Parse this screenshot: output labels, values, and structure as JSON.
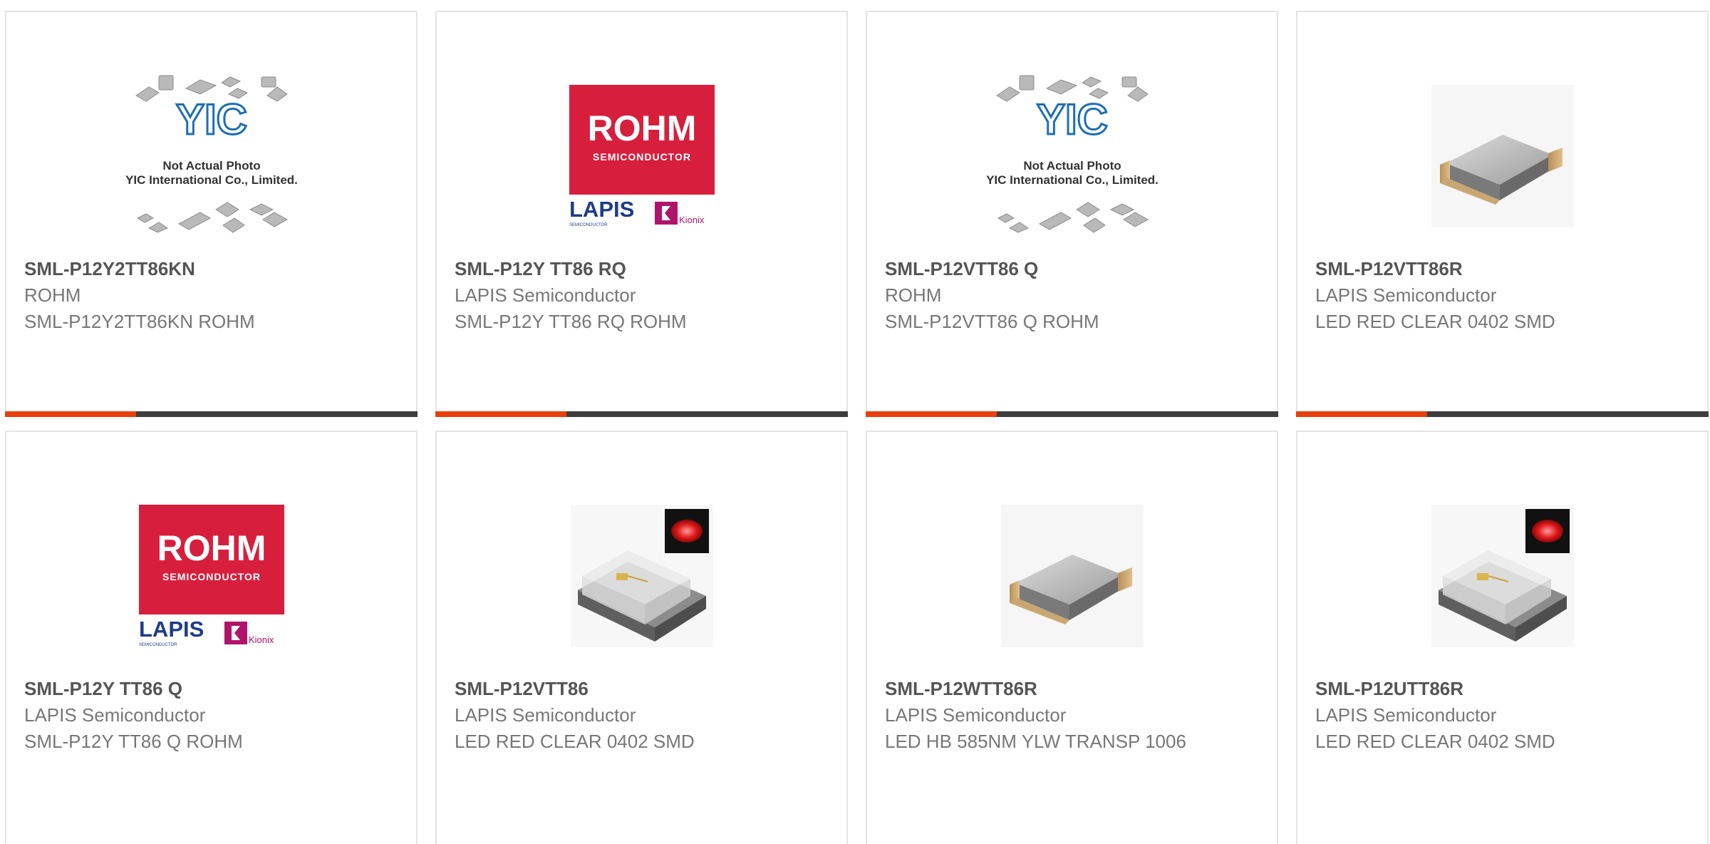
{
  "colors": {
    "accent": "#e8400c",
    "bar": "#3d3d3d",
    "rohm_red": "#d71f3d",
    "lapis_blue": "#1f3c8a",
    "kionix_magenta": "#b0146a",
    "yic_blue": "#1d6fb5"
  },
  "placeholder_logo": {
    "brand": "YIC",
    "line1": "Not Actual Photo",
    "line2": "YIC International Co., Limited."
  },
  "rohm_logo": {
    "brand": "ROHM",
    "sub": "SEMICONDUCTOR",
    "lapis": "LAPIS",
    "lapis_sub": "SEMICONDUCTOR",
    "kionix": "Kionix"
  },
  "products": [
    {
      "part": "SML-P12Y2TT86KN",
      "manufacturer": "ROHM",
      "description": "SML-P12Y2TT86KN ROHM",
      "image": "yic-placeholder-image"
    },
    {
      "part": "SML-P12Y TT86 RQ",
      "manufacturer": "LAPIS Semiconductor",
      "description": "SML-P12Y TT86 RQ ROHM",
      "image": "rohm-lapis-logo"
    },
    {
      "part": "SML-P12VTT86 Q",
      "manufacturer": "ROHM",
      "description": "SML-P12VTT86 Q ROHM",
      "image": "yic-placeholder-image"
    },
    {
      "part": "SML-P12VTT86R",
      "manufacturer": "LAPIS Semiconductor",
      "description": "LED RED CLEAR 0402 SMD",
      "image": "smd-chip-image"
    },
    {
      "part": "SML-P12Y TT86 Q",
      "manufacturer": "LAPIS Semiconductor",
      "description": "SML-P12Y TT86 Q ROHM",
      "image": "rohm-lapis-logo"
    },
    {
      "part": "SML-P12VTT86",
      "manufacturer": "LAPIS Semiconductor",
      "description": "LED RED CLEAR 0402 SMD",
      "image": "clear-led-red-image"
    },
    {
      "part": "SML-P12WTT86R",
      "manufacturer": "LAPIS Semiconductor",
      "description": "LED HB 585NM YLW TRANSP 1006",
      "image": "smd-chip-image"
    },
    {
      "part": "SML-P12UTT86R",
      "manufacturer": "LAPIS Semiconductor",
      "description": "LED RED CLEAR 0402 SMD",
      "image": "clear-led-red-image"
    }
  ]
}
